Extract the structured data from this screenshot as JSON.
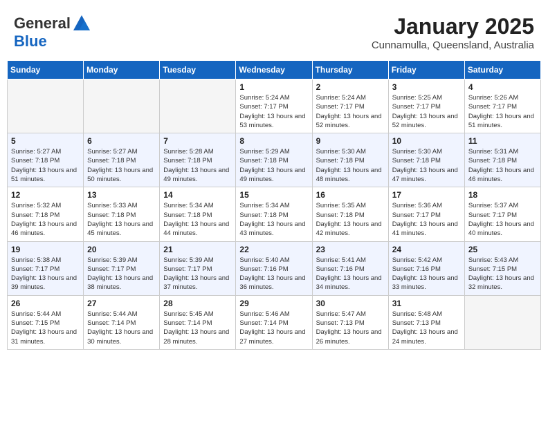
{
  "header": {
    "logo_general": "General",
    "logo_blue": "Blue",
    "month": "January 2025",
    "location": "Cunnamulla, Queensland, Australia"
  },
  "weekdays": [
    "Sunday",
    "Monday",
    "Tuesday",
    "Wednesday",
    "Thursday",
    "Friday",
    "Saturday"
  ],
  "weeks": [
    [
      {
        "day": "",
        "sunrise": "",
        "sunset": "",
        "daylight": ""
      },
      {
        "day": "",
        "sunrise": "",
        "sunset": "",
        "daylight": ""
      },
      {
        "day": "",
        "sunrise": "",
        "sunset": "",
        "daylight": ""
      },
      {
        "day": "1",
        "sunrise": "Sunrise: 5:24 AM",
        "sunset": "Sunset: 7:17 PM",
        "daylight": "Daylight: 13 hours and 53 minutes."
      },
      {
        "day": "2",
        "sunrise": "Sunrise: 5:24 AM",
        "sunset": "Sunset: 7:17 PM",
        "daylight": "Daylight: 13 hours and 52 minutes."
      },
      {
        "day": "3",
        "sunrise": "Sunrise: 5:25 AM",
        "sunset": "Sunset: 7:17 PM",
        "daylight": "Daylight: 13 hours and 52 minutes."
      },
      {
        "day": "4",
        "sunrise": "Sunrise: 5:26 AM",
        "sunset": "Sunset: 7:17 PM",
        "daylight": "Daylight: 13 hours and 51 minutes."
      }
    ],
    [
      {
        "day": "5",
        "sunrise": "Sunrise: 5:27 AM",
        "sunset": "Sunset: 7:18 PM",
        "daylight": "Daylight: 13 hours and 51 minutes."
      },
      {
        "day": "6",
        "sunrise": "Sunrise: 5:27 AM",
        "sunset": "Sunset: 7:18 PM",
        "daylight": "Daylight: 13 hours and 50 minutes."
      },
      {
        "day": "7",
        "sunrise": "Sunrise: 5:28 AM",
        "sunset": "Sunset: 7:18 PM",
        "daylight": "Daylight: 13 hours and 49 minutes."
      },
      {
        "day": "8",
        "sunrise": "Sunrise: 5:29 AM",
        "sunset": "Sunset: 7:18 PM",
        "daylight": "Daylight: 13 hours and 49 minutes."
      },
      {
        "day": "9",
        "sunrise": "Sunrise: 5:30 AM",
        "sunset": "Sunset: 7:18 PM",
        "daylight": "Daylight: 13 hours and 48 minutes."
      },
      {
        "day": "10",
        "sunrise": "Sunrise: 5:30 AM",
        "sunset": "Sunset: 7:18 PM",
        "daylight": "Daylight: 13 hours and 47 minutes."
      },
      {
        "day": "11",
        "sunrise": "Sunrise: 5:31 AM",
        "sunset": "Sunset: 7:18 PM",
        "daylight": "Daylight: 13 hours and 46 minutes."
      }
    ],
    [
      {
        "day": "12",
        "sunrise": "Sunrise: 5:32 AM",
        "sunset": "Sunset: 7:18 PM",
        "daylight": "Daylight: 13 hours and 46 minutes."
      },
      {
        "day": "13",
        "sunrise": "Sunrise: 5:33 AM",
        "sunset": "Sunset: 7:18 PM",
        "daylight": "Daylight: 13 hours and 45 minutes."
      },
      {
        "day": "14",
        "sunrise": "Sunrise: 5:34 AM",
        "sunset": "Sunset: 7:18 PM",
        "daylight": "Daylight: 13 hours and 44 minutes."
      },
      {
        "day": "15",
        "sunrise": "Sunrise: 5:34 AM",
        "sunset": "Sunset: 7:18 PM",
        "daylight": "Daylight: 13 hours and 43 minutes."
      },
      {
        "day": "16",
        "sunrise": "Sunrise: 5:35 AM",
        "sunset": "Sunset: 7:18 PM",
        "daylight": "Daylight: 13 hours and 42 minutes."
      },
      {
        "day": "17",
        "sunrise": "Sunrise: 5:36 AM",
        "sunset": "Sunset: 7:17 PM",
        "daylight": "Daylight: 13 hours and 41 minutes."
      },
      {
        "day": "18",
        "sunrise": "Sunrise: 5:37 AM",
        "sunset": "Sunset: 7:17 PM",
        "daylight": "Daylight: 13 hours and 40 minutes."
      }
    ],
    [
      {
        "day": "19",
        "sunrise": "Sunrise: 5:38 AM",
        "sunset": "Sunset: 7:17 PM",
        "daylight": "Daylight: 13 hours and 39 minutes."
      },
      {
        "day": "20",
        "sunrise": "Sunrise: 5:39 AM",
        "sunset": "Sunset: 7:17 PM",
        "daylight": "Daylight: 13 hours and 38 minutes."
      },
      {
        "day": "21",
        "sunrise": "Sunrise: 5:39 AM",
        "sunset": "Sunset: 7:17 PM",
        "daylight": "Daylight: 13 hours and 37 minutes."
      },
      {
        "day": "22",
        "sunrise": "Sunrise: 5:40 AM",
        "sunset": "Sunset: 7:16 PM",
        "daylight": "Daylight: 13 hours and 36 minutes."
      },
      {
        "day": "23",
        "sunrise": "Sunrise: 5:41 AM",
        "sunset": "Sunset: 7:16 PM",
        "daylight": "Daylight: 13 hours and 34 minutes."
      },
      {
        "day": "24",
        "sunrise": "Sunrise: 5:42 AM",
        "sunset": "Sunset: 7:16 PM",
        "daylight": "Daylight: 13 hours and 33 minutes."
      },
      {
        "day": "25",
        "sunrise": "Sunrise: 5:43 AM",
        "sunset": "Sunset: 7:15 PM",
        "daylight": "Daylight: 13 hours and 32 minutes."
      }
    ],
    [
      {
        "day": "26",
        "sunrise": "Sunrise: 5:44 AM",
        "sunset": "Sunset: 7:15 PM",
        "daylight": "Daylight: 13 hours and 31 minutes."
      },
      {
        "day": "27",
        "sunrise": "Sunrise: 5:44 AM",
        "sunset": "Sunset: 7:14 PM",
        "daylight": "Daylight: 13 hours and 30 minutes."
      },
      {
        "day": "28",
        "sunrise": "Sunrise: 5:45 AM",
        "sunset": "Sunset: 7:14 PM",
        "daylight": "Daylight: 13 hours and 28 minutes."
      },
      {
        "day": "29",
        "sunrise": "Sunrise: 5:46 AM",
        "sunset": "Sunset: 7:14 PM",
        "daylight": "Daylight: 13 hours and 27 minutes."
      },
      {
        "day": "30",
        "sunrise": "Sunrise: 5:47 AM",
        "sunset": "Sunset: 7:13 PM",
        "daylight": "Daylight: 13 hours and 26 minutes."
      },
      {
        "day": "31",
        "sunrise": "Sunrise: 5:48 AM",
        "sunset": "Sunset: 7:13 PM",
        "daylight": "Daylight: 13 hours and 24 minutes."
      },
      {
        "day": "",
        "sunrise": "",
        "sunset": "",
        "daylight": ""
      }
    ]
  ]
}
